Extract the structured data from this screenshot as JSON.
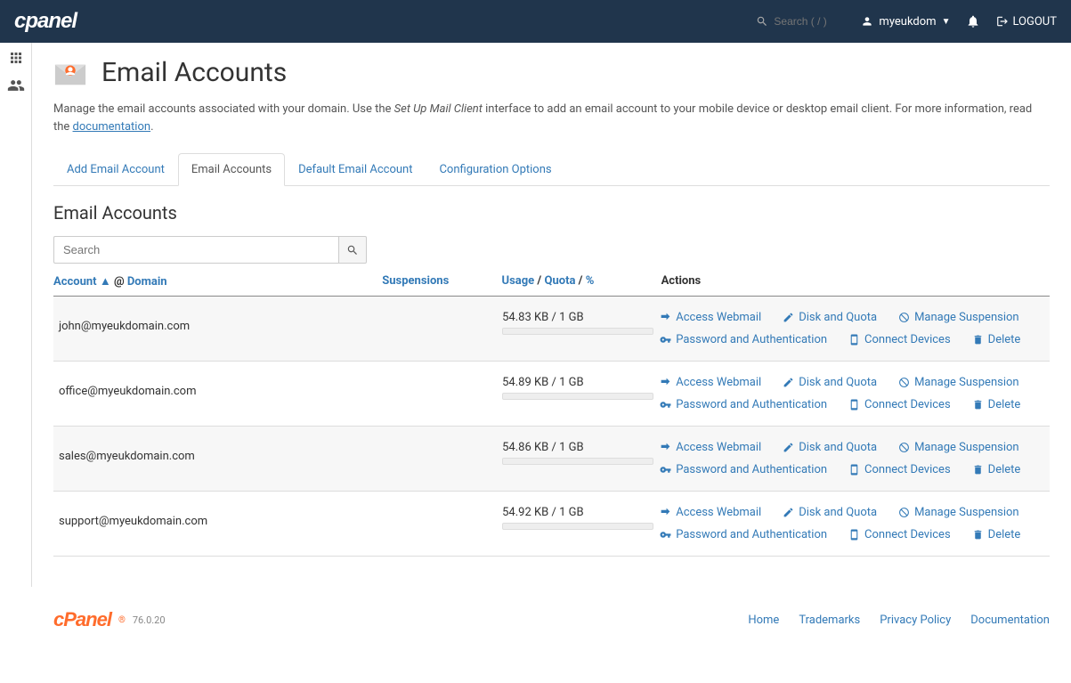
{
  "header": {
    "logo": "cPanel",
    "search_placeholder": "Search ( / )",
    "user": "myeukdom",
    "logout": "LOGOUT"
  },
  "page": {
    "title": "Email Accounts",
    "description_pre": "Manage the email accounts associated with your domain. Use the ",
    "description_em": "Set Up Mail Client",
    "description_mid": " interface to add an email account to your mobile device or desktop email client. For more information, read the ",
    "documentation_label": "documentation",
    "description_post": "."
  },
  "tabs": [
    {
      "label": "Add Email Account",
      "active": false
    },
    {
      "label": "Email Accounts",
      "active": true
    },
    {
      "label": "Default Email Account",
      "active": false
    },
    {
      "label": "Configuration Options",
      "active": false
    }
  ],
  "section_title": "Email Accounts",
  "search": {
    "placeholder": "Search"
  },
  "table_headers": {
    "account": "Account",
    "sort_indicator": "▲",
    "at": "@",
    "domain": "Domain",
    "suspensions": "Suspensions",
    "usage": "Usage",
    "quota": "Quota",
    "percent": "%",
    "actions": "Actions",
    "sep": " / "
  },
  "accounts": [
    {
      "email": "john@myeukdomain.com",
      "usage": "54.83 KB / 1 GB"
    },
    {
      "email": "office@myeukdomain.com",
      "usage": "54.89 KB / 1 GB"
    },
    {
      "email": "sales@myeukdomain.com",
      "usage": "54.86 KB / 1 GB"
    },
    {
      "email": "support@myeukdomain.com",
      "usage": "54.92 KB / 1 GB"
    }
  ],
  "action_labels": {
    "webmail": "Access Webmail",
    "disk": "Disk and Quota",
    "manage_susp": "Manage Suspension",
    "password": "Password and Authentication",
    "connect": "Connect Devices",
    "delete": "Delete"
  },
  "footer": {
    "logo": "cPanel",
    "version": "76.0.20",
    "links": [
      "Home",
      "Trademarks",
      "Privacy Policy",
      "Documentation"
    ]
  }
}
